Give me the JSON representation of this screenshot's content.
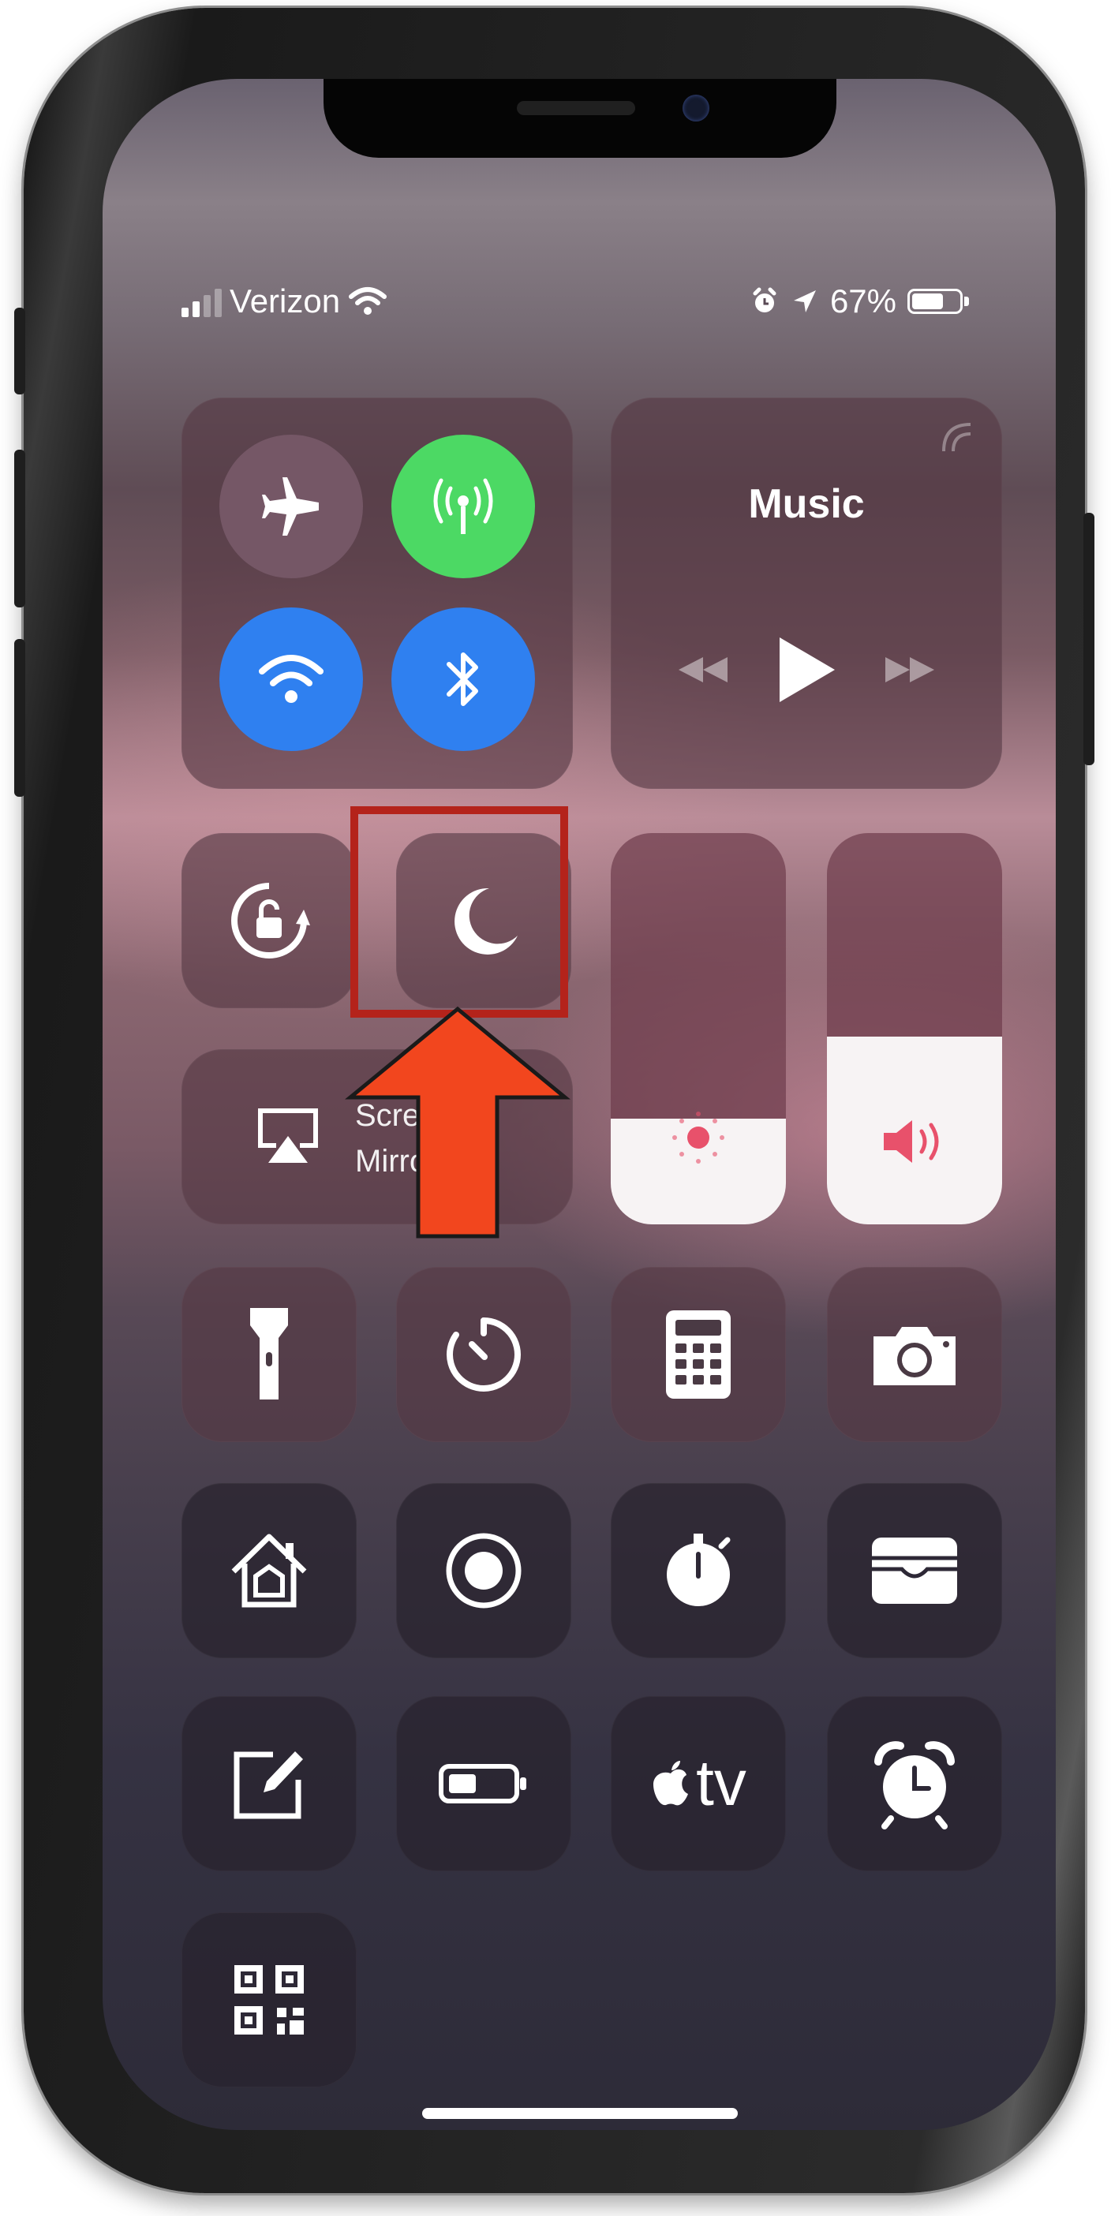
{
  "status_bar": {
    "carrier": "Verizon",
    "battery_text": "67%",
    "battery_level": 0.67
  },
  "music": {
    "title": "Music"
  },
  "screen_mirroring": {
    "label_line1": "Screen",
    "label_line2": "Mirroring"
  },
  "sliders": {
    "brightness_level": 0.27,
    "volume_level": 0.48
  },
  "controls": {
    "airplane": {
      "icon": "airplane-icon",
      "state": "off"
    },
    "cellular": {
      "icon": "antenna-icon",
      "state": "on",
      "color": "#4cd964"
    },
    "wifi": {
      "icon": "wifi-icon",
      "state": "on",
      "color": "#2f80f0"
    },
    "bluetooth": {
      "icon": "bluetooth-icon",
      "state": "on",
      "color": "#2f80f0"
    },
    "orientation_lock": {
      "icon": "rotation-lock-icon"
    },
    "do_not_disturb": {
      "icon": "moon-icon"
    },
    "row1": [
      "flashlight-icon",
      "timer-icon",
      "calculator-icon",
      "camera-icon"
    ],
    "row2": [
      "home-icon",
      "screen-record-icon",
      "stopwatch-icon",
      "wallet-icon"
    ],
    "row3": [
      "notes-icon",
      "low-power-icon",
      "apple-tv-icon",
      "alarm-icon"
    ],
    "row4": [
      "qr-code-icon"
    ]
  },
  "apple_tv_label": "tv",
  "annotation": {
    "highlight_color": "#b4231b",
    "arrow_color": "#f2461e"
  }
}
